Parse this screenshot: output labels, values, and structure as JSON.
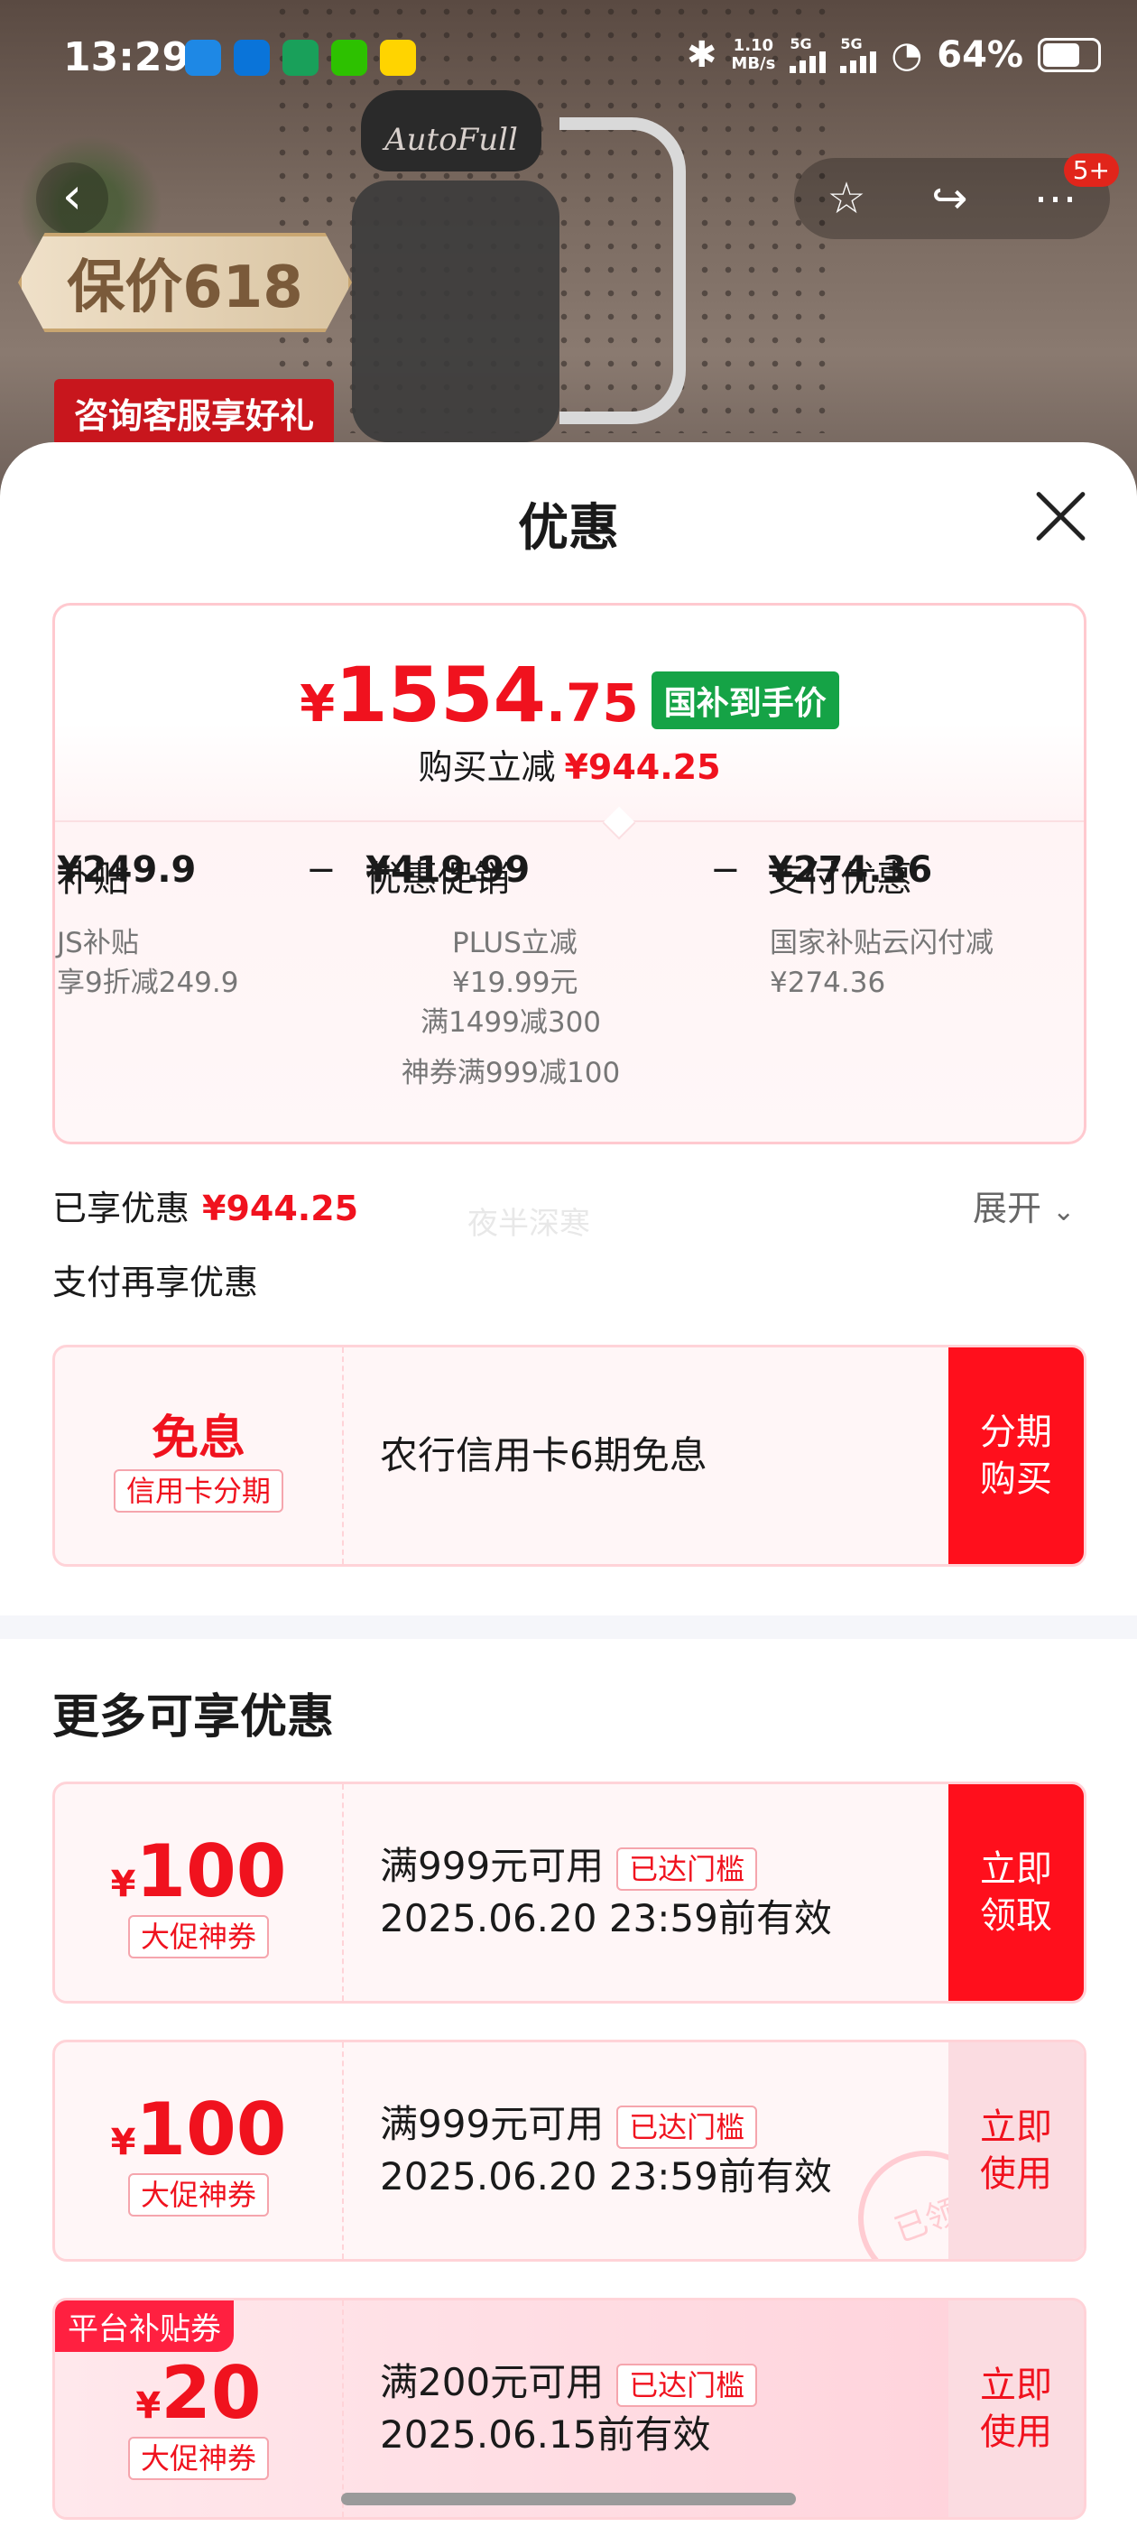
{
  "status_bar": {
    "time": "13:29",
    "net_speed_top": "1.10",
    "net_speed_bottom": "MB/s",
    "sig1": "5G",
    "sig2": "5G",
    "battery": "64%"
  },
  "product_bg": {
    "brand_logo": "AutoFull",
    "promo_tag": "保价618",
    "promo_red": "咨询客服享好礼",
    "nav_badge": "5+"
  },
  "sheet": {
    "title": "优惠",
    "price": {
      "symbol": "¥",
      "integer": "1554",
      "decimal": ".75",
      "badge": "国补到手价",
      "sub_label": "购买立减",
      "sub_amount": "¥944.25"
    },
    "breakdown": {
      "subsidy_label": "补贴",
      "subsidy_amount": "¥249.9",
      "minus1": "−",
      "promo_label": "优惠促销",
      "promo_amount": "¥419.99",
      "minus2": "−",
      "pay_label": "支付优惠",
      "pay_amount": "¥274.36"
    },
    "details": {
      "subsidy_l1": "JS补贴",
      "subsidy_l2": "享9折减249.9",
      "promo_l1": "PLUS立减",
      "promo_l2": "¥19.99元",
      "promo_l3": "满1499减300",
      "promo_l4": "神券满999减100",
      "pay_l1": "国家补贴云闪付减",
      "pay_l2": "¥274.36"
    },
    "enjoyed_label": "已享优惠",
    "enjoyed_amount": "¥944.25",
    "expand": "展开",
    "watermark": "夜半深寒",
    "pay_more": "支付再享优惠",
    "installment": {
      "title": "免息",
      "badge": "信用卡分期",
      "desc": "农行信用卡6期免息",
      "action_l1": "分期",
      "action_l2": "购买"
    },
    "more_title": "更多可享优惠",
    "coupons": [
      {
        "symbol": "¥",
        "amount": "100",
        "type": "大促神券",
        "condition": "满999元可用",
        "threshold": "已达门槛",
        "expiry": "2025.06.20 23:59前有效",
        "action_l1": "立即",
        "action_l2": "领取"
      },
      {
        "symbol": "¥",
        "amount": "100",
        "type": "大促神券",
        "condition": "满999元可用",
        "threshold": "已达门槛",
        "expiry": "2025.06.20 23:59前有效",
        "action_l1": "立即",
        "action_l2": "使用",
        "stamp": "已领"
      },
      {
        "symbol": "¥",
        "amount": "20",
        "type": "大促神券",
        "condition": "满200元可用",
        "threshold": "已达门槛",
        "expiry": "2025.06.15前有效",
        "action_l1": "立即",
        "action_l2": "使用",
        "platform_tag": "平台补贴券"
      }
    ]
  },
  "colors": {
    "accent_red": "#f0121e",
    "green_badge": "#15a346"
  }
}
